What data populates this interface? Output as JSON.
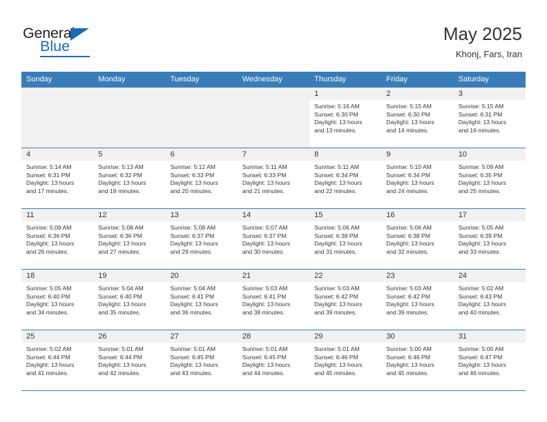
{
  "brand": {
    "name_part1": "General",
    "name_part2": "Blue",
    "accent_color": "#1b6cb0"
  },
  "header": {
    "title": "May 2025",
    "subtitle": "Khonj, Fars, Iran"
  },
  "theme": {
    "header_row_color": "#3a7cb8",
    "daynum_band_color": "#f1f1f1",
    "text_color": "#333333"
  },
  "weekdays": [
    "Sunday",
    "Monday",
    "Tuesday",
    "Wednesday",
    "Thursday",
    "Friday",
    "Saturday"
  ],
  "weeks": [
    [
      {
        "day": "",
        "empty": true,
        "lines": []
      },
      {
        "day": "",
        "empty": true,
        "lines": []
      },
      {
        "day": "",
        "empty": true,
        "lines": []
      },
      {
        "day": "",
        "empty": true,
        "lines": []
      },
      {
        "day": "1",
        "empty": false,
        "lines": [
          "Sunrise: 5:16 AM",
          "Sunset: 6:30 PM",
          "Daylight: 13 hours",
          "and 13 minutes."
        ]
      },
      {
        "day": "2",
        "empty": false,
        "lines": [
          "Sunrise: 5:15 AM",
          "Sunset: 6:30 PM",
          "Daylight: 13 hours",
          "and 14 minutes."
        ]
      },
      {
        "day": "3",
        "empty": false,
        "lines": [
          "Sunrise: 5:15 AM",
          "Sunset: 6:31 PM",
          "Daylight: 13 hours",
          "and 16 minutes."
        ]
      }
    ],
    [
      {
        "day": "4",
        "empty": false,
        "lines": [
          "Sunrise: 5:14 AM",
          "Sunset: 6:31 PM",
          "Daylight: 13 hours",
          "and 17 minutes."
        ]
      },
      {
        "day": "5",
        "empty": false,
        "lines": [
          "Sunrise: 5:13 AM",
          "Sunset: 6:32 PM",
          "Daylight: 13 hours",
          "and 19 minutes."
        ]
      },
      {
        "day": "6",
        "empty": false,
        "lines": [
          "Sunrise: 5:12 AM",
          "Sunset: 6:33 PM",
          "Daylight: 13 hours",
          "and 20 minutes."
        ]
      },
      {
        "day": "7",
        "empty": false,
        "lines": [
          "Sunrise: 5:11 AM",
          "Sunset: 6:33 PM",
          "Daylight: 13 hours",
          "and 21 minutes."
        ]
      },
      {
        "day": "8",
        "empty": false,
        "lines": [
          "Sunrise: 5:11 AM",
          "Sunset: 6:34 PM",
          "Daylight: 13 hours",
          "and 22 minutes."
        ]
      },
      {
        "day": "9",
        "empty": false,
        "lines": [
          "Sunrise: 5:10 AM",
          "Sunset: 6:34 PM",
          "Daylight: 13 hours",
          "and 24 minutes."
        ]
      },
      {
        "day": "10",
        "empty": false,
        "lines": [
          "Sunrise: 5:09 AM",
          "Sunset: 6:35 PM",
          "Daylight: 13 hours",
          "and 25 minutes."
        ]
      }
    ],
    [
      {
        "day": "11",
        "empty": false,
        "lines": [
          "Sunrise: 5:09 AM",
          "Sunset: 6:36 PM",
          "Daylight: 13 hours",
          "and 26 minutes."
        ]
      },
      {
        "day": "12",
        "empty": false,
        "lines": [
          "Sunrise: 5:08 AM",
          "Sunset: 6:36 PM",
          "Daylight: 13 hours",
          "and 27 minutes."
        ]
      },
      {
        "day": "13",
        "empty": false,
        "lines": [
          "Sunrise: 5:08 AM",
          "Sunset: 6:37 PM",
          "Daylight: 13 hours",
          "and 29 minutes."
        ]
      },
      {
        "day": "14",
        "empty": false,
        "lines": [
          "Sunrise: 5:07 AM",
          "Sunset: 6:37 PM",
          "Daylight: 13 hours",
          "and 30 minutes."
        ]
      },
      {
        "day": "15",
        "empty": false,
        "lines": [
          "Sunrise: 5:06 AM",
          "Sunset: 6:38 PM",
          "Daylight: 13 hours",
          "and 31 minutes."
        ]
      },
      {
        "day": "16",
        "empty": false,
        "lines": [
          "Sunrise: 5:06 AM",
          "Sunset: 6:38 PM",
          "Daylight: 13 hours",
          "and 32 minutes."
        ]
      },
      {
        "day": "17",
        "empty": false,
        "lines": [
          "Sunrise: 5:05 AM",
          "Sunset: 6:39 PM",
          "Daylight: 13 hours",
          "and 33 minutes."
        ]
      }
    ],
    [
      {
        "day": "18",
        "empty": false,
        "lines": [
          "Sunrise: 5:05 AM",
          "Sunset: 6:40 PM",
          "Daylight: 13 hours",
          "and 34 minutes."
        ]
      },
      {
        "day": "19",
        "empty": false,
        "lines": [
          "Sunrise: 5:04 AM",
          "Sunset: 6:40 PM",
          "Daylight: 13 hours",
          "and 35 minutes."
        ]
      },
      {
        "day": "20",
        "empty": false,
        "lines": [
          "Sunrise: 5:04 AM",
          "Sunset: 6:41 PM",
          "Daylight: 13 hours",
          "and 36 minutes."
        ]
      },
      {
        "day": "21",
        "empty": false,
        "lines": [
          "Sunrise: 5:03 AM",
          "Sunset: 6:41 PM",
          "Daylight: 13 hours",
          "and 38 minutes."
        ]
      },
      {
        "day": "22",
        "empty": false,
        "lines": [
          "Sunrise: 5:03 AM",
          "Sunset: 6:42 PM",
          "Daylight: 13 hours",
          "and 39 minutes."
        ]
      },
      {
        "day": "23",
        "empty": false,
        "lines": [
          "Sunrise: 5:03 AM",
          "Sunset: 6:42 PM",
          "Daylight: 13 hours",
          "and 39 minutes."
        ]
      },
      {
        "day": "24",
        "empty": false,
        "lines": [
          "Sunrise: 5:02 AM",
          "Sunset: 6:43 PM",
          "Daylight: 13 hours",
          "and 40 minutes."
        ]
      }
    ],
    [
      {
        "day": "25",
        "empty": false,
        "lines": [
          "Sunrise: 5:02 AM",
          "Sunset: 6:44 PM",
          "Daylight: 13 hours",
          "and 41 minutes."
        ]
      },
      {
        "day": "26",
        "empty": false,
        "lines": [
          "Sunrise: 5:01 AM",
          "Sunset: 6:44 PM",
          "Daylight: 13 hours",
          "and 42 minutes."
        ]
      },
      {
        "day": "27",
        "empty": false,
        "lines": [
          "Sunrise: 5:01 AM",
          "Sunset: 6:45 PM",
          "Daylight: 13 hours",
          "and 43 minutes."
        ]
      },
      {
        "day": "28",
        "empty": false,
        "lines": [
          "Sunrise: 5:01 AM",
          "Sunset: 6:45 PM",
          "Daylight: 13 hours",
          "and 44 minutes."
        ]
      },
      {
        "day": "29",
        "empty": false,
        "lines": [
          "Sunrise: 5:01 AM",
          "Sunset: 6:46 PM",
          "Daylight: 13 hours",
          "and 45 minutes."
        ]
      },
      {
        "day": "30",
        "empty": false,
        "lines": [
          "Sunrise: 5:00 AM",
          "Sunset: 6:46 PM",
          "Daylight: 13 hours",
          "and 45 minutes."
        ]
      },
      {
        "day": "31",
        "empty": false,
        "lines": [
          "Sunrise: 5:00 AM",
          "Sunset: 6:47 PM",
          "Daylight: 13 hours",
          "and 46 minutes."
        ]
      }
    ]
  ]
}
